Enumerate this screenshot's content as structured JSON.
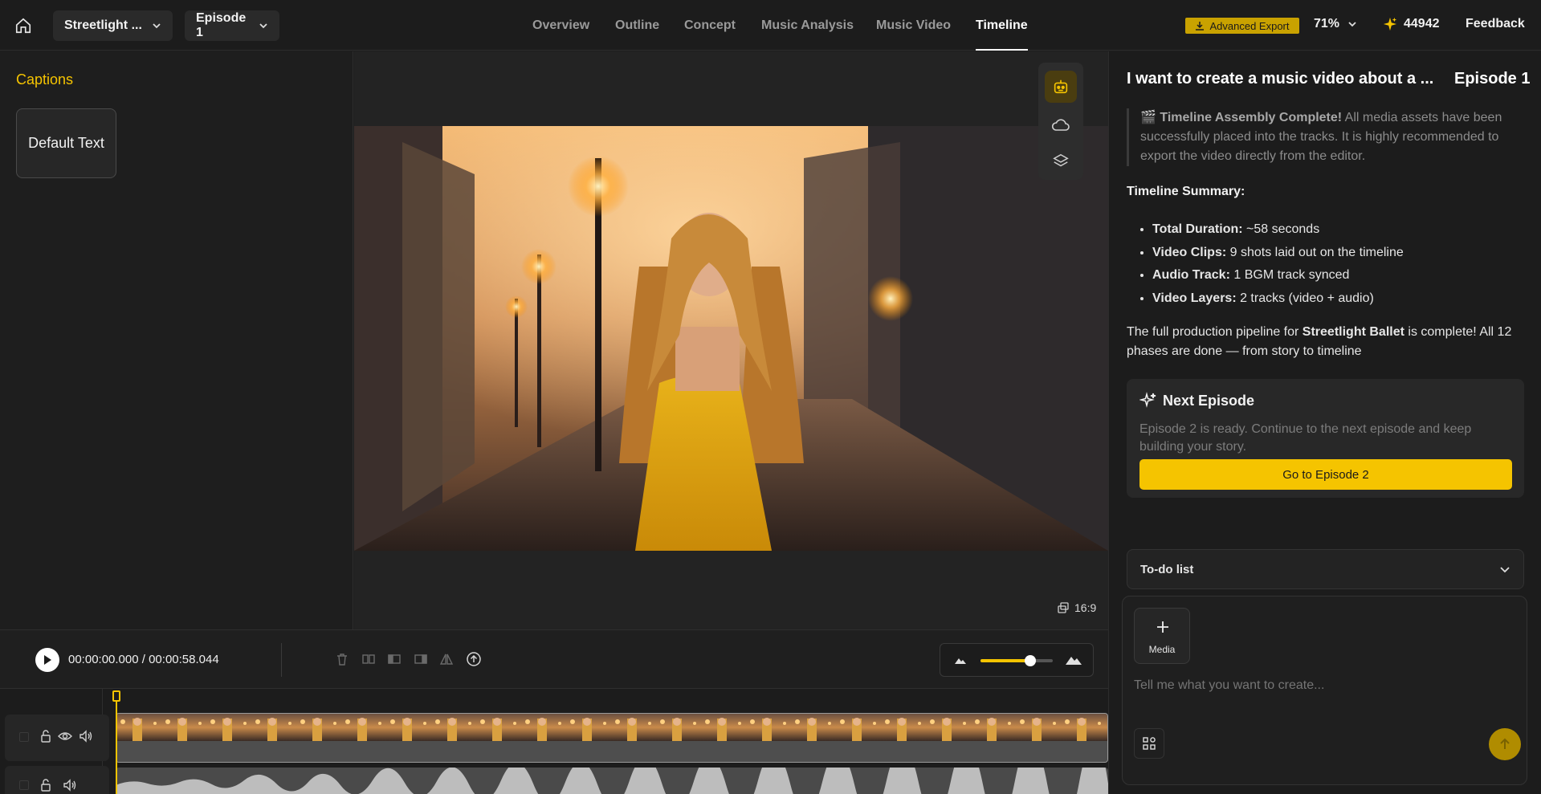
{
  "topbar": {
    "project": "Streetlight ...",
    "episode": "Episode 1",
    "nav": [
      "Overview",
      "Outline",
      "Concept",
      "Music Analysis",
      "Music Video",
      "Timeline"
    ],
    "active_nav": "Timeline",
    "advanced_export": "Advanced Export",
    "zoom": "71%",
    "credits": "44942",
    "feedback": "Feedback"
  },
  "left": {
    "captions_title": "Captions",
    "default_text": "Default Text"
  },
  "preview": {
    "aspect": "16:9"
  },
  "controls": {
    "time": "00:00:00.000 / 00:00:58.044",
    "zoom_fraction": 0.69
  },
  "chat": {
    "title": "I want to create a music video about a ...",
    "episode": "Episode 1",
    "note_emoji": "🎬",
    "note_bold": "Timeline Assembly Complete!",
    "note_text": " All media assets have been successfully placed into the tracks. It is highly recommended to export the video directly from the editor.",
    "summary_heading": "Timeline Summary:",
    "items": [
      {
        "label": "Total Duration:",
        "value": " ~58 seconds"
      },
      {
        "label": "Video Clips:",
        "value": " 9 shots laid out on the timeline"
      },
      {
        "label": "Audio Track:",
        "value": " 1 BGM track synced"
      },
      {
        "label": "Video Layers:",
        "value": " 2 tracks (video + audio)"
      }
    ],
    "pipeline_pre": "The full production pipeline for ",
    "pipeline_bold": "Streetlight Ballet",
    "pipeline_post": " is complete! All 12 phases are done — from story to timeline",
    "next_title": "Next Episode",
    "next_desc": "Episode 2 is ready. Continue to the next episode and keep building your story.",
    "next_button": "Go to Episode 2",
    "todo": "To-do list",
    "media_label": "Media",
    "input_placeholder": "Tell me what you want to create..."
  },
  "colors": {
    "accent": "#f5c400",
    "bg": "#1e1e1e"
  }
}
